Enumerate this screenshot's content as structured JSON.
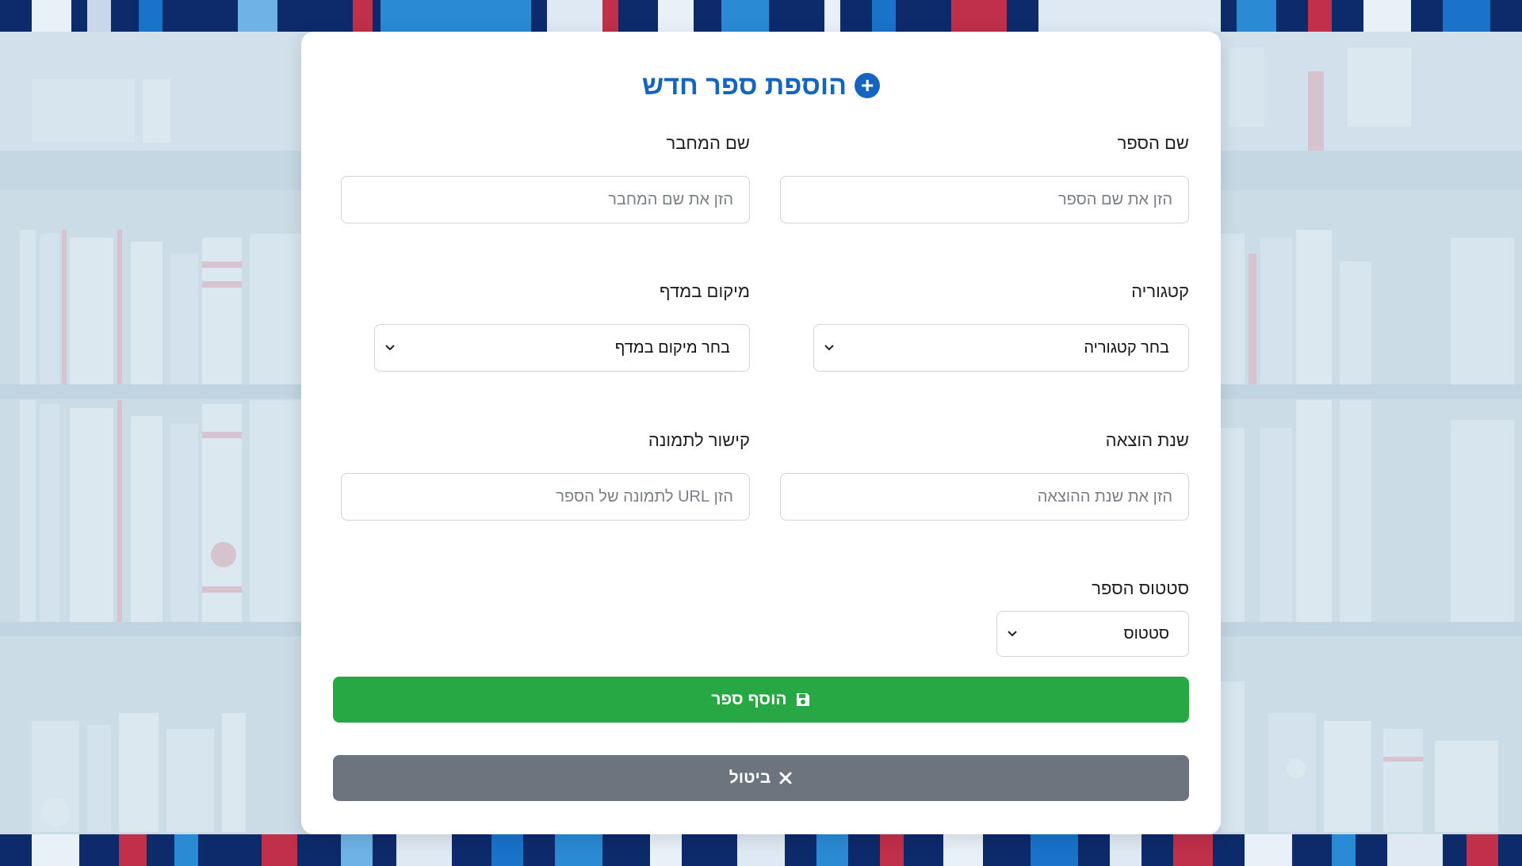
{
  "form": {
    "title": "הוספת ספר חדש",
    "title_icon": "plus-circle-icon",
    "fields": {
      "book_name": {
        "label": "שם הספר",
        "placeholder": "הזן את שם הספר",
        "value": ""
      },
      "author_name": {
        "label": "שם המחבר",
        "placeholder": "הזן את שם המחבר",
        "value": ""
      },
      "category": {
        "label": "קטגוריה",
        "selected": "בחר קטגוריה"
      },
      "shelf_location": {
        "label": "מיקום במדף",
        "selected": "בחר מיקום במדף"
      },
      "publish_year": {
        "label": "שנת הוצאה",
        "placeholder": "הזן את שנת ההוצאה",
        "value": ""
      },
      "image_link": {
        "label": "קישור לתמונה",
        "placeholder": "הזן URL לתמונה של הספר",
        "value": ""
      },
      "book_status": {
        "label": "סטטוס הספר",
        "selected": "סטטוס"
      }
    },
    "buttons": {
      "add_label": "הוסף ספר",
      "add_icon": "save-icon",
      "cancel_label": "ביטול",
      "cancel_icon": "close-icon"
    }
  },
  "colors": {
    "accent": "#1565c0",
    "add_button": "#28a745",
    "cancel_button": "#6c757d",
    "background": "#c7d7e2"
  }
}
